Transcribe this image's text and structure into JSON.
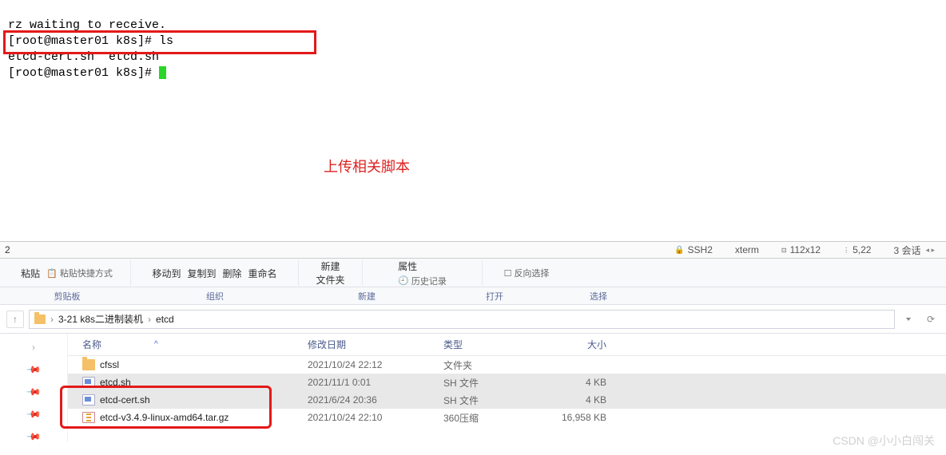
{
  "terminal": {
    "line1": "rz waiting to receive.",
    "line2": "[root@master01 k8s]# ls",
    "line3": "etcd-cert.sh  etcd.sh",
    "line4": "[root@master01 k8s]# "
  },
  "annotation": "上传相关脚本",
  "statusbar": {
    "left": "2",
    "ssh": "SSH2",
    "term": "xterm",
    "size": "112x12",
    "pos": "5,22",
    "sessions": "3 会话"
  },
  "ribbon": {
    "paste": "粘贴",
    "paste_shortcut": "粘贴快捷方式",
    "move": "移动到",
    "copy": "复制到",
    "delete": "删除",
    "rename": "重命名",
    "newfolder": "新建\n文件夹",
    "props": "属性",
    "history": "历史记录",
    "invert": "反向选择"
  },
  "sections": {
    "clipboard": "剪贴板",
    "organize": "组织",
    "new": "新建",
    "open": "打开",
    "select": "选择"
  },
  "breadcrumb": {
    "item1": "3-21 k8s二进制装机",
    "item2": "etcd"
  },
  "columns": {
    "name": "名称",
    "date": "修改日期",
    "type": "类型",
    "size": "大小"
  },
  "files": [
    {
      "name": "cfssl",
      "date": "2021/10/24 22:12",
      "type": "文件夹",
      "size": "",
      "icon": "folder",
      "sel": false
    },
    {
      "name": "etcd.sh",
      "date": "2021/11/1 0:01",
      "type": "SH 文件",
      "size": "4 KB",
      "icon": "sh",
      "sel": true
    },
    {
      "name": "etcd-cert.sh",
      "date": "2021/6/24 20:36",
      "type": "SH 文件",
      "size": "4 KB",
      "icon": "sh",
      "sel": true
    },
    {
      "name": "etcd-v3.4.9-linux-amd64.tar.gz",
      "date": "2021/10/24 22:10",
      "type": "360压缩",
      "size": "16,958 KB",
      "icon": "archive",
      "sel": false
    }
  ],
  "watermark": "CSDN @小小白闯关"
}
